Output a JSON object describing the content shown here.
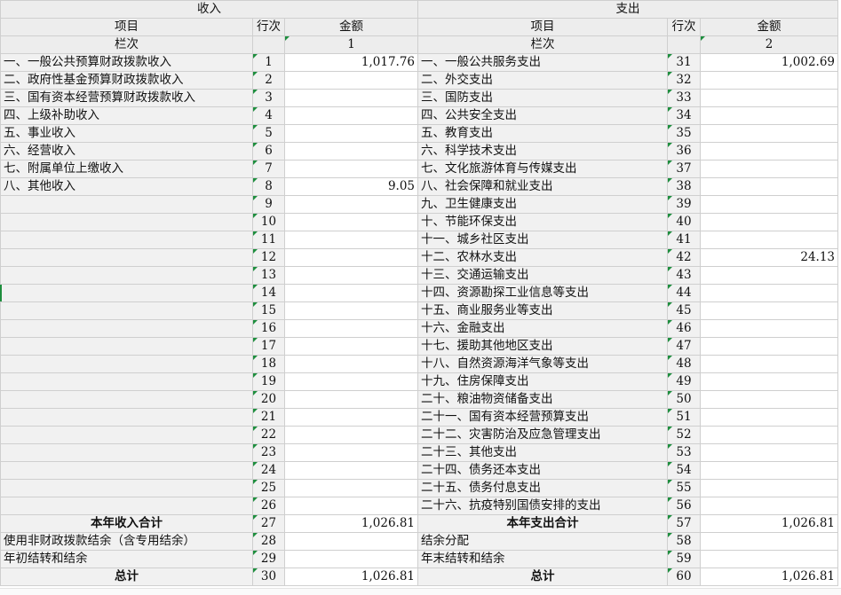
{
  "header": {
    "income_title": "收入",
    "expense_title": "支出",
    "col_item": "项目",
    "col_line": "行次",
    "col_amount": "金额",
    "col_index_label": "栏次",
    "income_col_no": "1",
    "expense_col_no": "2"
  },
  "rows": [
    {
      "in_item": "一、一般公共预算财政拨款收入",
      "in_line": "1",
      "in_amt": "1,017.76",
      "ex_item": "一、一般公共服务支出",
      "ex_line": "31",
      "ex_amt": "1,002.69"
    },
    {
      "in_item": "二、政府性基金预算财政拨款收入",
      "in_line": "2",
      "in_amt": "",
      "ex_item": "二、外交支出",
      "ex_line": "32",
      "ex_amt": ""
    },
    {
      "in_item": "三、国有资本经营预算财政拨款收入",
      "in_line": "3",
      "in_amt": "",
      "ex_item": "三、国防支出",
      "ex_line": "33",
      "ex_amt": ""
    },
    {
      "in_item": "四、上级补助收入",
      "in_line": "4",
      "in_amt": "",
      "ex_item": "四、公共安全支出",
      "ex_line": "34",
      "ex_amt": ""
    },
    {
      "in_item": "五、事业收入",
      "in_line": "5",
      "in_amt": "",
      "ex_item": "五、教育支出",
      "ex_line": "35",
      "ex_amt": ""
    },
    {
      "in_item": "六、经营收入",
      "in_line": "6",
      "in_amt": "",
      "ex_item": "六、科学技术支出",
      "ex_line": "36",
      "ex_amt": ""
    },
    {
      "in_item": "七、附属单位上缴收入",
      "in_line": "7",
      "in_amt": "",
      "ex_item": "七、文化旅游体育与传媒支出",
      "ex_line": "37",
      "ex_amt": ""
    },
    {
      "in_item": "八、其他收入",
      "in_line": "8",
      "in_amt": "9.05",
      "ex_item": "八、社会保障和就业支出",
      "ex_line": "38",
      "ex_amt": ""
    },
    {
      "in_item": "",
      "in_line": "9",
      "in_amt": "",
      "ex_item": "九、卫生健康支出",
      "ex_line": "39",
      "ex_amt": ""
    },
    {
      "in_item": "",
      "in_line": "10",
      "in_amt": "",
      "ex_item": "十、节能环保支出",
      "ex_line": "40",
      "ex_amt": ""
    },
    {
      "in_item": "",
      "in_line": "11",
      "in_amt": "",
      "ex_item": "十一、城乡社区支出",
      "ex_line": "41",
      "ex_amt": ""
    },
    {
      "in_item": "",
      "in_line": "12",
      "in_amt": "",
      "ex_item": "十二、农林水支出",
      "ex_line": "42",
      "ex_amt": "24.13"
    },
    {
      "in_item": "",
      "in_line": "13",
      "in_amt": "",
      "ex_item": "十三、交通运输支出",
      "ex_line": "43",
      "ex_amt": ""
    },
    {
      "in_item": "",
      "in_line": "14",
      "in_amt": "",
      "ex_item": "十四、资源勘探工业信息等支出",
      "ex_line": "44",
      "ex_amt": ""
    },
    {
      "in_item": "",
      "in_line": "15",
      "in_amt": "",
      "ex_item": "十五、商业服务业等支出",
      "ex_line": "45",
      "ex_amt": ""
    },
    {
      "in_item": "",
      "in_line": "16",
      "in_amt": "",
      "ex_item": "十六、金融支出",
      "ex_line": "46",
      "ex_amt": ""
    },
    {
      "in_item": "",
      "in_line": "17",
      "in_amt": "",
      "ex_item": "十七、援助其他地区支出",
      "ex_line": "47",
      "ex_amt": ""
    },
    {
      "in_item": "",
      "in_line": "18",
      "in_amt": "",
      "ex_item": "十八、自然资源海洋气象等支出",
      "ex_line": "48",
      "ex_amt": ""
    },
    {
      "in_item": "",
      "in_line": "19",
      "in_amt": "",
      "ex_item": "十九、住房保障支出",
      "ex_line": "49",
      "ex_amt": ""
    },
    {
      "in_item": "",
      "in_line": "20",
      "in_amt": "",
      "ex_item": "二十、粮油物资储备支出",
      "ex_line": "50",
      "ex_amt": ""
    },
    {
      "in_item": "",
      "in_line": "21",
      "in_amt": "",
      "ex_item": "二十一、国有资本经营预算支出",
      "ex_line": "51",
      "ex_amt": ""
    },
    {
      "in_item": "",
      "in_line": "22",
      "in_amt": "",
      "ex_item": "二十二、灾害防治及应急管理支出",
      "ex_line": "52",
      "ex_amt": ""
    },
    {
      "in_item": "",
      "in_line": "23",
      "in_amt": "",
      "ex_item": "二十三、其他支出",
      "ex_line": "53",
      "ex_amt": ""
    },
    {
      "in_item": "",
      "in_line": "24",
      "in_amt": "",
      "ex_item": "二十四、债务还本支出",
      "ex_line": "54",
      "ex_amt": ""
    },
    {
      "in_item": "",
      "in_line": "25",
      "in_amt": "",
      "ex_item": "二十五、债务付息支出",
      "ex_line": "55",
      "ex_amt": ""
    },
    {
      "in_item": "",
      "in_line": "26",
      "in_amt": "",
      "ex_item": "二十六、抗疫特别国债安排的支出",
      "ex_line": "56",
      "ex_amt": ""
    }
  ],
  "totals": {
    "in_total_label": "本年收入合计",
    "in_total_line": "27",
    "in_total_amt": "1,026.81",
    "ex_total_label": "本年支出合计",
    "ex_total_line": "57",
    "ex_total_amt": "1,026.81",
    "r1_in_item": "使用非财政拨款结余（含专用结余）",
    "r1_in_line": "28",
    "r1_ex_item": "结余分配",
    "r1_ex_line": "58",
    "r2_in_item": "年初结转和结余",
    "r2_in_line": "29",
    "r2_ex_item": "年末结转和结余",
    "r2_ex_line": "59",
    "grand_in_label": "总计",
    "grand_in_line": "30",
    "grand_in_amt": "1,026.81",
    "grand_ex_label": "总计",
    "grand_ex_line": "60",
    "grand_ex_amt": "1,026.81"
  }
}
